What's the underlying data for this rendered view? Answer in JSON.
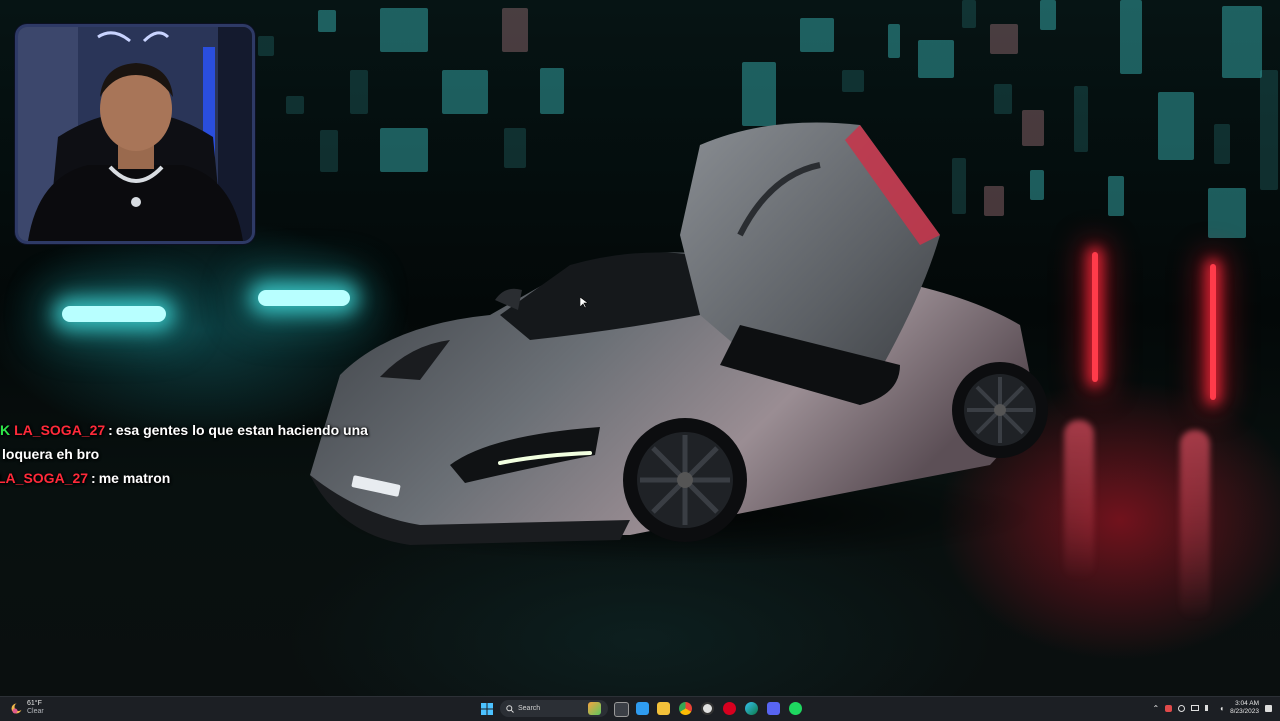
{
  "chat": {
    "messages": [
      {
        "badge": "K",
        "user": "LA_SOGA_27",
        "separator": ":",
        "text": "esa gentes lo que estan haciendo una",
        "continuation": "loquera eh bro"
      },
      {
        "badge": "",
        "user": "LA_SOGA_27",
        "separator": ":",
        "text": "me matron",
        "continuation": ""
      }
    ]
  },
  "taskbar": {
    "weather": {
      "temperature": "61°F",
      "condition": "Clear"
    },
    "search": {
      "placeholder": "Search"
    },
    "apps": [
      "widget-app-icon",
      "task-view-icon",
      "file-explorer-icon",
      "chrome-icon",
      "obs-icon",
      "opera-icon",
      "edge-icon",
      "discord-icon",
      "spotify-icon"
    ],
    "clock": {
      "time": "3:04 AM",
      "date": "8/23/2023"
    }
  },
  "colors": {
    "chat_user": "#ff2a3a",
    "chat_badge": "#2ee64a",
    "neon_cyan": "#b8ffff",
    "neon_red": "#ff3b4a",
    "taskbar_bg": "#1c1f24"
  }
}
